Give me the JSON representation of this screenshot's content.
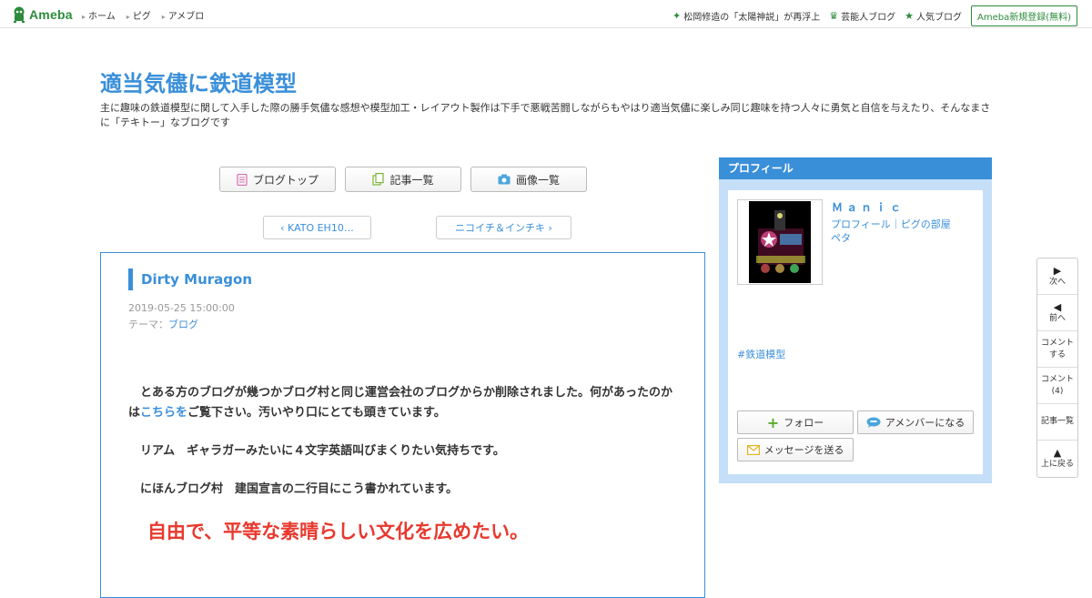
{
  "topbar": {
    "logo_text": "Ameba",
    "nav": [
      "ホーム",
      "ピグ",
      "アメブロ"
    ],
    "right_items": [
      {
        "icon": "sparkle-icon",
        "label": "松岡修造の「太陽神説」が再浮上"
      },
      {
        "icon": "crown-icon",
        "label": "芸能人ブログ"
      },
      {
        "icon": "star-icon",
        "label": "人気ブログ"
      }
    ],
    "register_label": "Ameba新規登録(無料)"
  },
  "header": {
    "title": "適当気儘に鉄道模型",
    "description": "主に趣味の鉄道模型に関して入手した際の勝手気儘な感想や模型加工・レイアウト製作は下手で悪戦苦闘しながらもやはり適当気儘に楽しみ同じ趣味を持つ人々に勇気と自信を与えたり、そんなまさに「テキトー」なブログです"
  },
  "nav_buttons": {
    "blog_top": "ブログトップ",
    "entry_list": "記事一覧",
    "image_list": "画像一覧"
  },
  "pager": {
    "prev": "KATO EH10…",
    "next": "ニコイチ＆インチキ"
  },
  "article": {
    "title": "Dirty Muragon",
    "date": "2019-05-25 15:00:00",
    "theme_label": "テーマ：",
    "theme": "ブログ",
    "p1_a": "　とある方のブログが幾つかブログ村と同じ運営会社のブログからか削除されました。何があったのかは",
    "p1_link": "こちらを",
    "p1_b": "ご覧下さい。汚いやり口にとても頭きています。",
    "p2": "　リアム　ギャラガーみたいに４文字英語叫びまくりたい気持ちです。",
    "p3": "　にほんブログ村　建国宣言の二行目にこう書かれています。",
    "p4": "　自由で、平等な素晴らしい文化を広めたい。"
  },
  "profile": {
    "header": "プロフィール",
    "name": "Ｍａｎｉｃ",
    "link_profile": "プロフィール",
    "link_separator": "｜",
    "link_room": "ピグの部屋",
    "link_peta": "ペタ",
    "tag": "#鉄道模型",
    "follow": "フォロー",
    "member": "アメンバーになる",
    "message": "メッセージを送る"
  },
  "sidenav": [
    {
      "icon": "play-right-icon",
      "label": "次へ"
    },
    {
      "icon": "play-left-icon",
      "label": "前へ"
    },
    {
      "icon": "",
      "label": "コメント\nする"
    },
    {
      "icon": "",
      "label": "コメント\n(4)"
    },
    {
      "icon": "",
      "label": "記事一覧"
    },
    {
      "icon": "triangle-up-icon",
      "label": "上に戻る"
    }
  ]
}
